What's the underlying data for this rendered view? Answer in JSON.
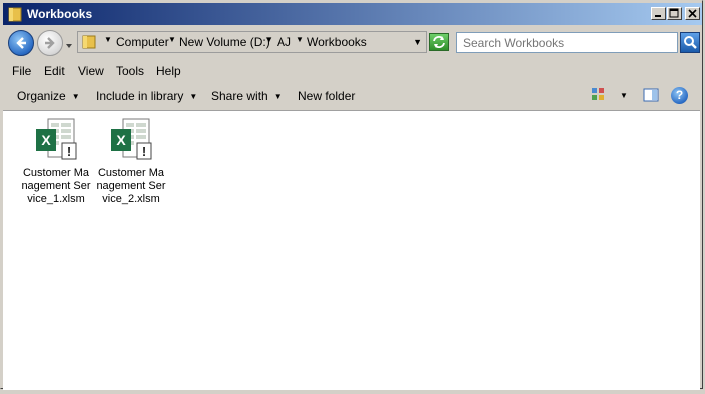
{
  "window": {
    "title": "Workbooks"
  },
  "address": {
    "breadcrumbs": [
      "Computer",
      "New Volume (D:)",
      "AJ",
      "Workbooks"
    ]
  },
  "search": {
    "placeholder": "Search Workbooks"
  },
  "menu": {
    "items": [
      "File",
      "Edit",
      "View",
      "Tools",
      "Help"
    ]
  },
  "commands": {
    "organize": "Organize",
    "include_in_library": "Include in library",
    "share_with": "Share with",
    "new_folder": "New folder"
  },
  "files": [
    {
      "name": "Customer Management Service_1.xlsm",
      "icon": "excel-macro-icon"
    },
    {
      "name": "Customer Management Service_2.xlsm",
      "icon": "excel-macro-icon"
    }
  ],
  "colors": {
    "titlebar_start": "#0a246a",
    "titlebar_end": "#a6caf0",
    "excel_green": "#1e7145"
  }
}
